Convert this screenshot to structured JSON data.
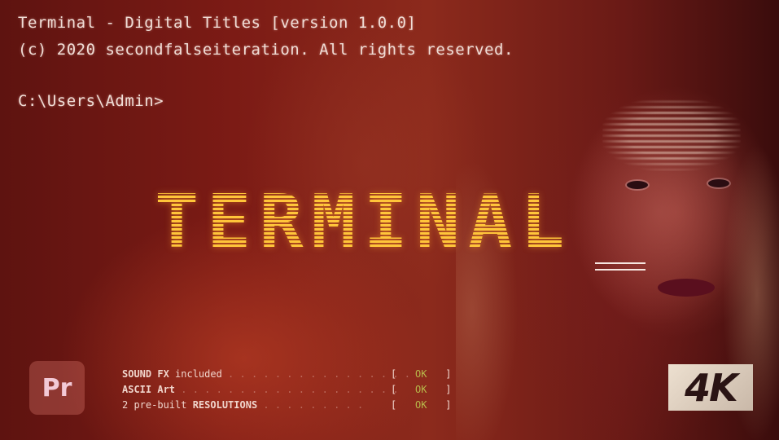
{
  "terminal": {
    "line1": "Terminal - Digital Titles [version 1.0.0]",
    "line2": "(c) 2020 secondfalseiteration. All rights reserved.",
    "prompt": "C:\\Users\\Admin>"
  },
  "title": "TERMINAL",
  "features": [
    {
      "label_prefix": "SOUND FX",
      "label_suffix": " included",
      "dots": " . . . . . . . . . . . . . . . .",
      "status": "OK"
    },
    {
      "label_prefix": "ASCII Art",
      "label_suffix": "",
      "dots": " . . . . . . . . . . . . . . . . . . .",
      "status": "OK"
    },
    {
      "label_prefix": "2 pre-built ",
      "label_suffix": "RESOLUTIONS",
      "dots": " . . . . . . . . .",
      "status": "OK"
    }
  ],
  "brackets": {
    "open": "[",
    "close": "]"
  },
  "app_badge": "Pr",
  "resolution_badge": "4K",
  "colors": {
    "title": "#ffb020",
    "ok": "#b7b84a",
    "background": "#7a1a14"
  }
}
